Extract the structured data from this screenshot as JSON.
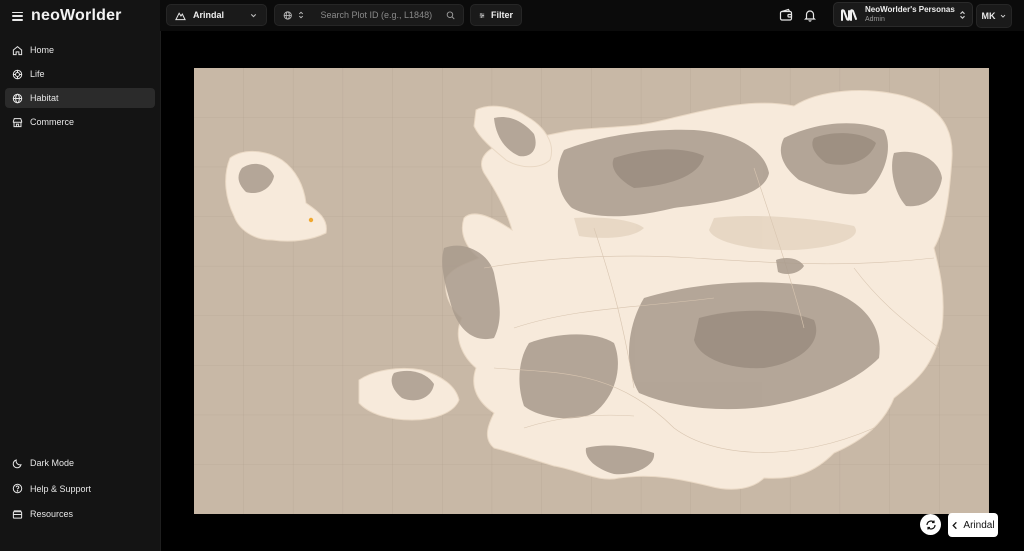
{
  "app": {
    "logo": "neoWorlder"
  },
  "sidebar": {
    "items": [
      {
        "label": "Home",
        "icon": "home-icon"
      },
      {
        "label": "Life",
        "icon": "life-icon"
      },
      {
        "label": "Habitat",
        "icon": "globe-icon",
        "active": true
      },
      {
        "label": "Commerce",
        "icon": "store-icon"
      }
    ],
    "bottom": [
      {
        "label": "Dark Mode",
        "icon": "moon-icon"
      },
      {
        "label": "Help & Support",
        "icon": "help-icon"
      },
      {
        "label": "Resources",
        "icon": "resources-icon"
      }
    ]
  },
  "topbar": {
    "world": "Arindal",
    "search_placeholder": "Search Plot ID (e.g., L1848)",
    "filter_label": "Filter",
    "persona": {
      "name": "NeoWorlder's Personas",
      "role": "Admin"
    },
    "user_initials": "MK"
  },
  "map": {
    "back_label": "Arindal"
  },
  "colors": {
    "accent": "#f0a830",
    "land": "#f7eadb",
    "water": "#c8b8a6",
    "terrain": "#a89a8c"
  }
}
